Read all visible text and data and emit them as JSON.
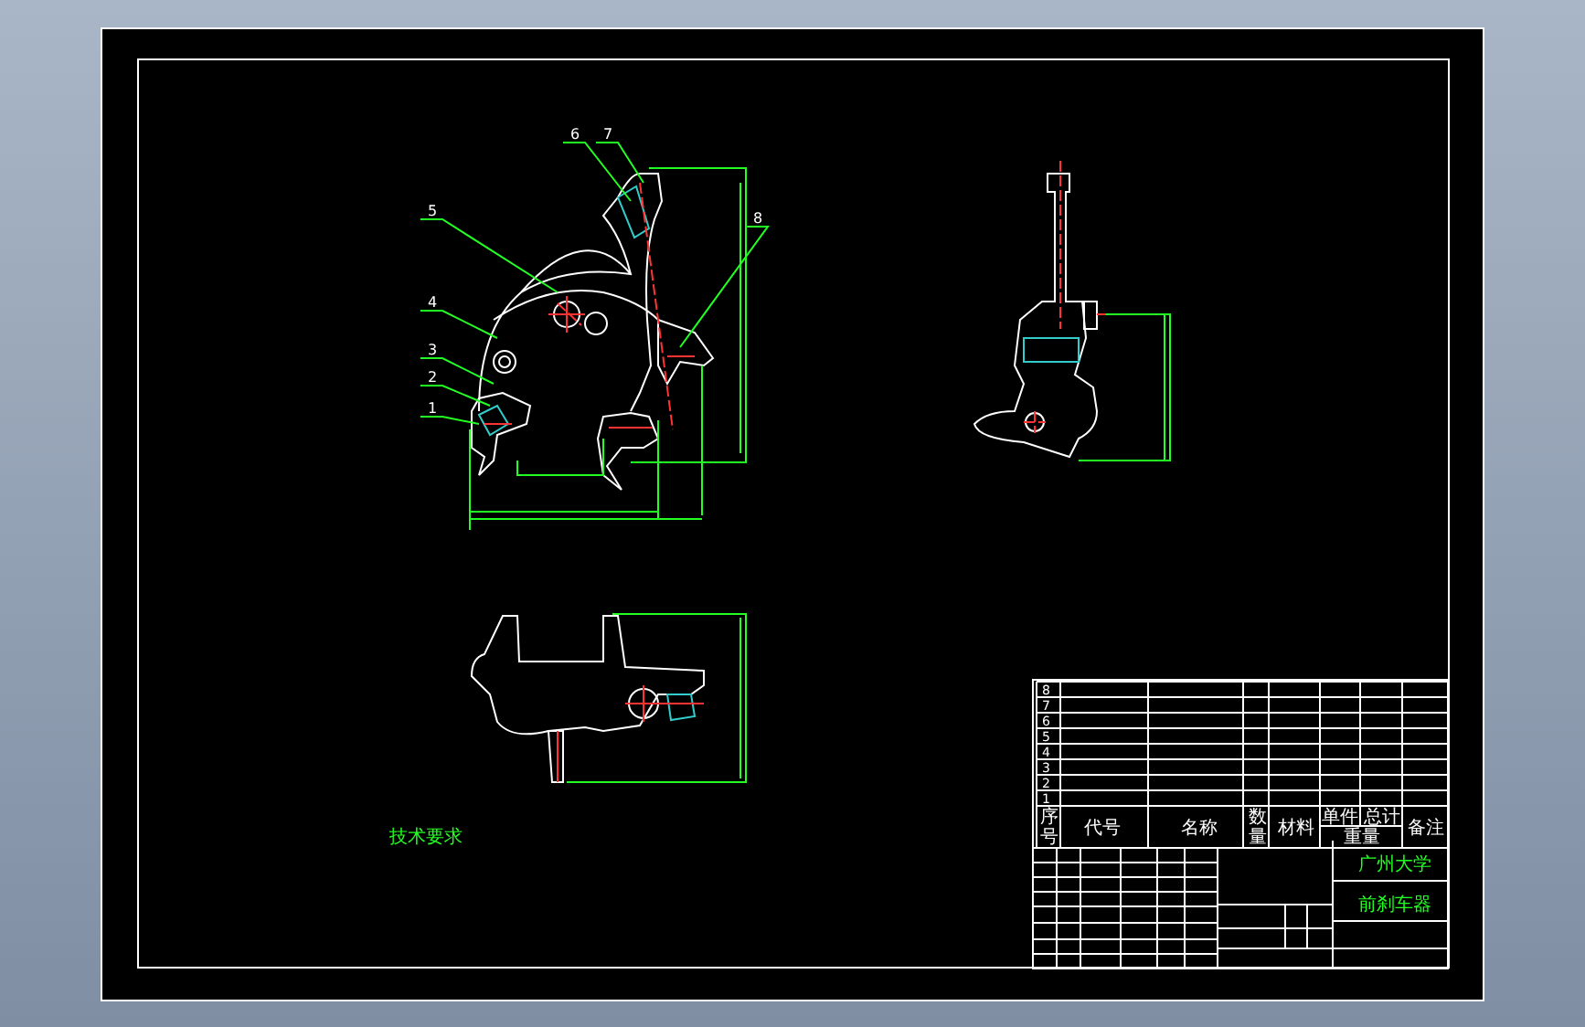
{
  "drawing": {
    "balloons": [
      {
        "label": "6"
      },
      {
        "label": "7"
      },
      {
        "label": "5"
      },
      {
        "label": "8"
      },
      {
        "label": "4"
      },
      {
        "label": "3"
      },
      {
        "label": "2"
      },
      {
        "label": "1"
      }
    ],
    "notes": {
      "title": "技术要求"
    },
    "title_block": {
      "part_numbers": [
        "8",
        "7",
        "6",
        "5",
        "4",
        "3",
        "2",
        "1"
      ],
      "headers": [
        "序号",
        "代号",
        "名称",
        "数量",
        "材料",
        "单件",
        "总计",
        "重量",
        "备注"
      ],
      "school": "广州大学",
      "drawing_name": "前刹车器"
    }
  }
}
